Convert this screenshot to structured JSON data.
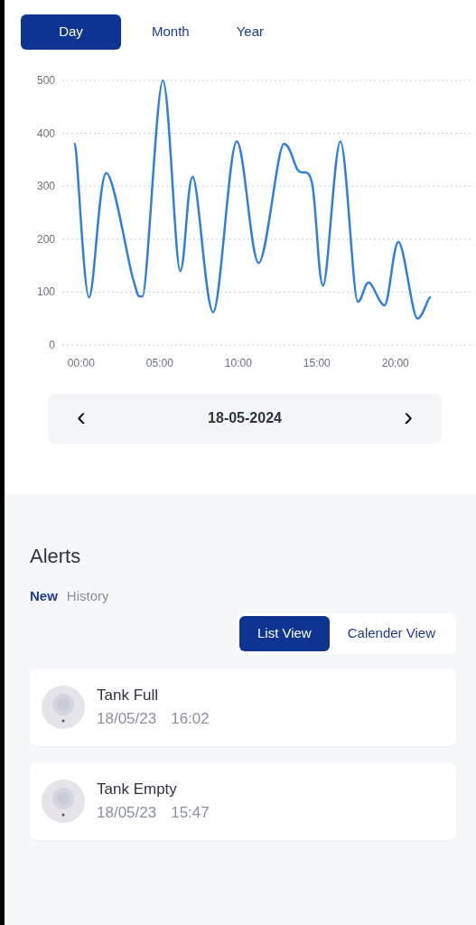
{
  "period_tabs": [
    {
      "label": "Day",
      "selected": true
    },
    {
      "label": "Month",
      "selected": false
    },
    {
      "label": "Year",
      "selected": false
    }
  ],
  "chart": {
    "chart_data": {
      "type": "line",
      "x": [
        -0.4,
        0.5,
        1.6,
        3.3,
        3.9,
        5.2,
        6.3,
        7.1,
        8.4,
        9.9,
        11.3,
        12.9,
        13.8,
        14.7,
        15.4,
        16.5,
        17.6,
        18.3,
        19.3,
        20.2,
        21.4,
        22.2
      ],
      "series": [
        {
          "color": "#2f7fe0",
          "values": [
            380,
            90,
            325,
            125,
            92,
            500,
            140,
            318,
            62,
            385,
            155,
            380,
            330,
            305,
            112,
            385,
            82,
            118,
            75,
            195,
            50,
            90
          ]
        }
      ],
      "xlim": [
        -1.2,
        24.9
      ],
      "ylim": [
        0,
        500
      ],
      "grid": true,
      "yticks": [
        0,
        100,
        200,
        300,
        400,
        500
      ],
      "xticks": [
        {
          "value": 0,
          "label": "00:00"
        },
        {
          "value": 5,
          "label": "05:00"
        },
        {
          "value": 10,
          "label": "10:00"
        },
        {
          "value": 15,
          "label": "15:00"
        },
        {
          "value": 20,
          "label": "20:00"
        }
      ]
    }
  },
  "date_nav": {
    "prev": "‹",
    "date": "18-05-2024",
    "next": "›"
  },
  "alerts": {
    "title": "Alerts",
    "tabs": [
      {
        "label": "New",
        "selected": true
      },
      {
        "label": "History",
        "selected": false
      }
    ],
    "views": [
      {
        "label": "List View",
        "selected": true
      },
      {
        "label": "Calender View",
        "selected": false
      }
    ],
    "items": [
      {
        "title": "Tank Full",
        "date": "18/05/23",
        "time": "16:02"
      },
      {
        "title": "Tank Empty",
        "date": "18/05/23",
        "time": "15:47"
      }
    ]
  }
}
